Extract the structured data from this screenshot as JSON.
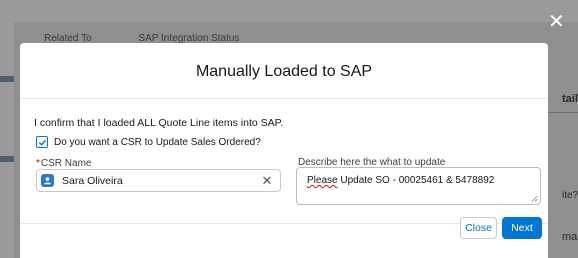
{
  "background": {
    "header_cols": [
      "Related To",
      "SAP Integration Status"
    ],
    "right_fragments": [
      "tail",
      "ite?",
      "ma"
    ]
  },
  "modal": {
    "title": "Manually Loaded to SAP",
    "confirm_text": "I confirm that I loaded ALL Quote Line items into SAP.",
    "checkbox_label": "Do you want a CSR to Update Sales Ordered?",
    "checkbox_checked": true,
    "csr_label_required": "*",
    "csr_label": "CSR Name",
    "csr_value": "Sara Oliveira",
    "describe_label": "Describe here the what to update",
    "describe_value_prefix": "Please",
    "describe_value_rest": " Update SO - 00025461 & 5478892",
    "close_label": "Close",
    "next_label": "Next"
  },
  "icons": {
    "close_overlay": "close-icon",
    "csr_avatar": "user-icon",
    "clear": "clear-icon",
    "check": "check-icon"
  },
  "colors": {
    "brand": "#0176d3",
    "required": "#ba0517",
    "avatar": "#2e79c7"
  }
}
